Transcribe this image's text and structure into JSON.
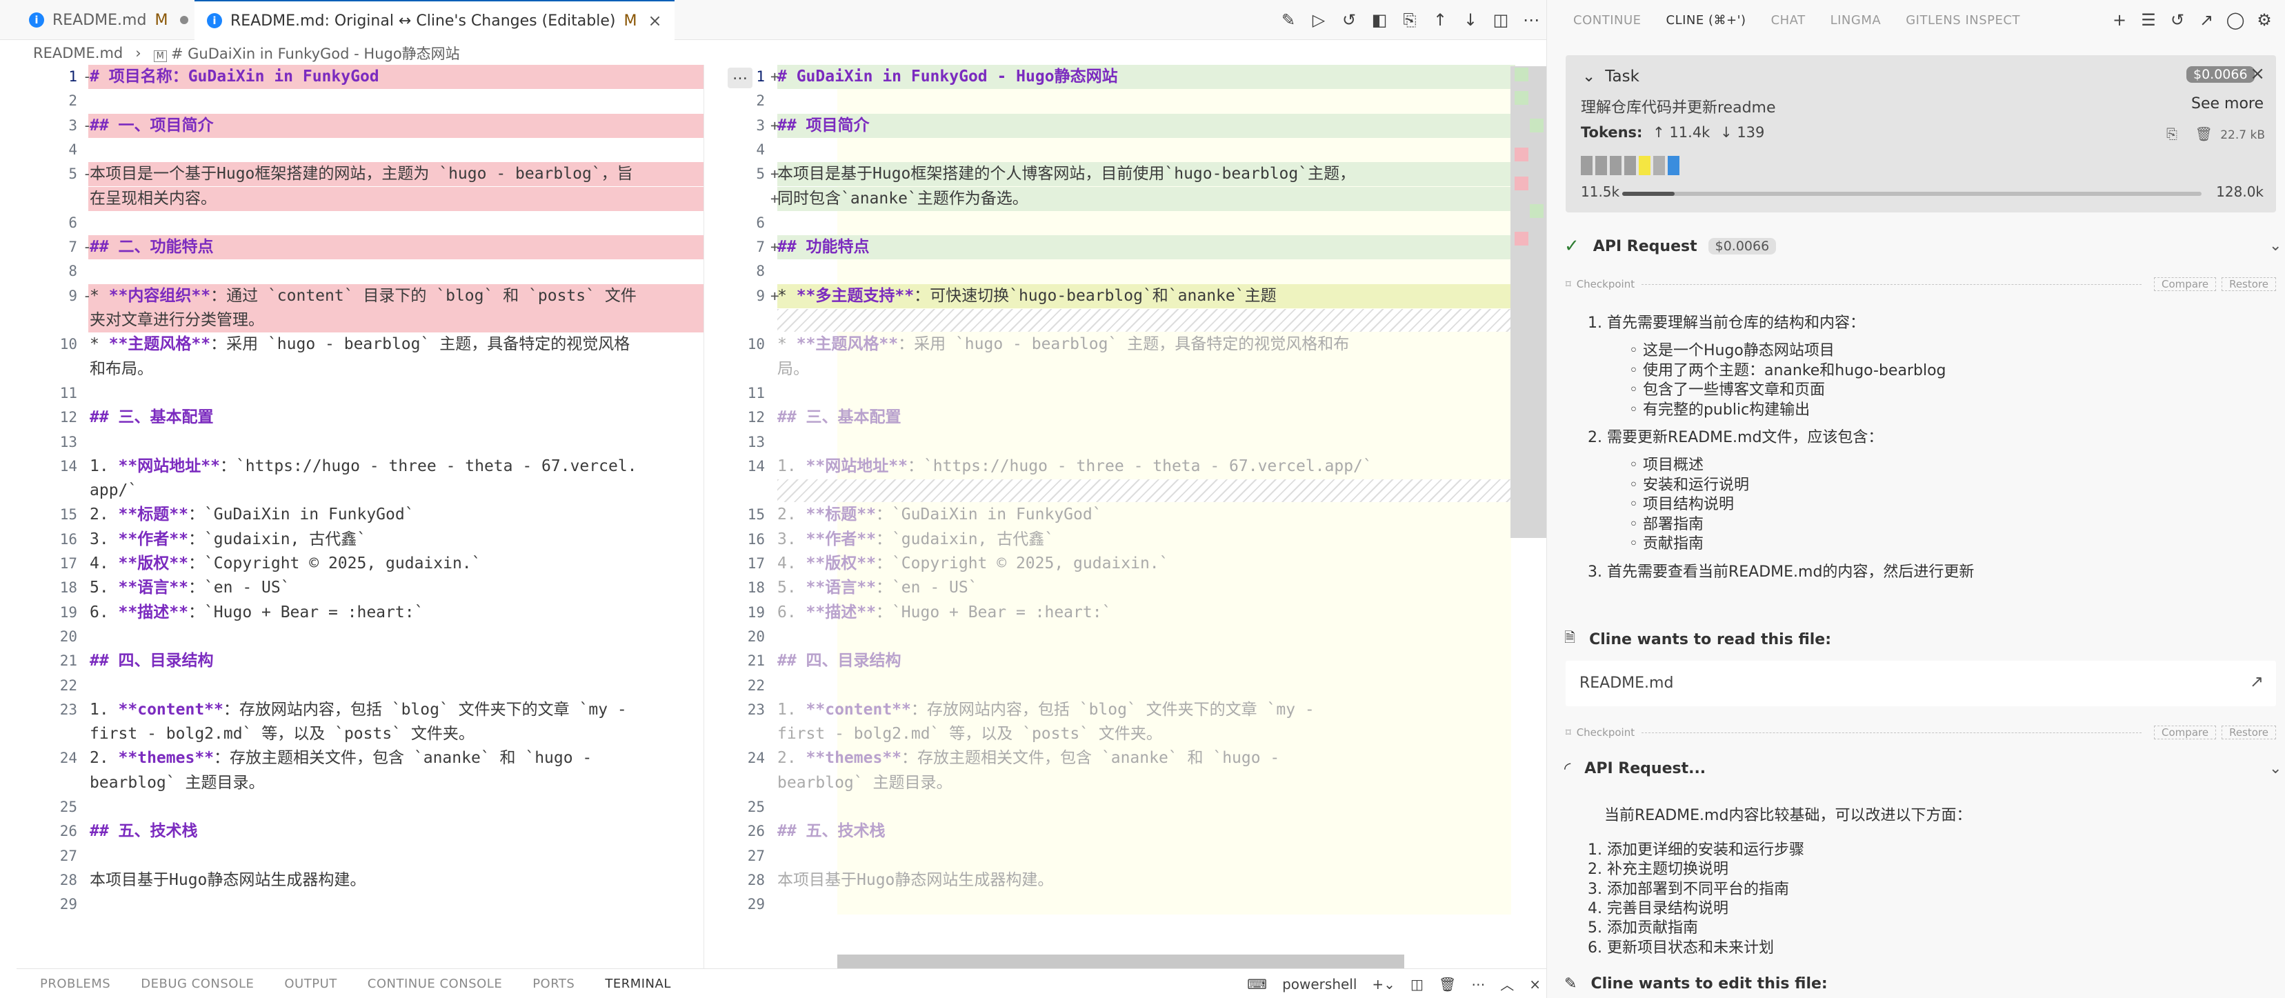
{
  "tabs": [
    {
      "label": "README.md",
      "status": "M"
    },
    {
      "label": "README.md: Original ↔ Cline's Changes (Editable)",
      "status": "M"
    }
  ],
  "breadcrumb": [
    "README.md",
    "# GuDaiXin in FunkyGod - Hugo静态网站"
  ],
  "left_lines": [
    {
      "n": "1",
      "mark": "-",
      "text": "# 项目名称：GuDaiXin in FunkyGod",
      "style": "heading",
      "bg": "del"
    },
    {
      "n": "2",
      "mark": "",
      "text": "",
      "bg": ""
    },
    {
      "n": "3",
      "mark": "-",
      "text": "## 一、项目简介",
      "style": "heading",
      "bg": "del"
    },
    {
      "n": "4",
      "mark": "",
      "text": "",
      "bg": ""
    },
    {
      "n": "5",
      "mark": "-",
      "text": "本项目是一个基于Hugo框架搭建的网站，主题为 `hugo - bearblog`，旨",
      "bg": "del"
    },
    {
      "n": "",
      "mark": "",
      "text": "在呈现相关内容。",
      "bg": "del"
    },
    {
      "n": "6",
      "mark": "",
      "text": "",
      "bg": ""
    },
    {
      "n": "7",
      "mark": "-",
      "text": "## 二、功能特点",
      "style": "heading",
      "bg": "del"
    },
    {
      "n": "8",
      "mark": "",
      "text": "",
      "bg": ""
    },
    {
      "n": "9",
      "mark": "-",
      "text": "* **内容组织**：通过 `content` 目录下的 `blog` 和 `posts` 文件",
      "style": "item",
      "bg": "del"
    },
    {
      "n": "",
      "mark": "",
      "text": "夹对文章进行分类管理。",
      "bg": "del"
    },
    {
      "n": "10",
      "mark": "",
      "text": "* **主题风格**：采用 `hugo - bearblog` 主题，具备特定的视觉风格",
      "style": "item",
      "bg": ""
    },
    {
      "n": "",
      "mark": "",
      "text": "和布局。",
      "bg": ""
    },
    {
      "n": "11",
      "mark": "",
      "text": "",
      "bg": ""
    },
    {
      "n": "12",
      "mark": "",
      "text": "## 三、基本配置",
      "style": "heading",
      "bg": ""
    },
    {
      "n": "13",
      "mark": "",
      "text": "",
      "bg": ""
    },
    {
      "n": "14",
      "mark": "",
      "text": "1. **网站地址**：`https://hugo - three - theta - 67.vercel.",
      "style": "item",
      "bg": ""
    },
    {
      "n": "",
      "mark": "",
      "text": "app/`",
      "bg": ""
    },
    {
      "n": "15",
      "mark": "",
      "text": "2. **标题**：`GuDaiXin in FunkyGod`",
      "style": "item",
      "bg": ""
    },
    {
      "n": "16",
      "mark": "",
      "text": "3. **作者**：`gudaixin, 古代鑫`",
      "style": "item",
      "bg": ""
    },
    {
      "n": "17",
      "mark": "",
      "text": "4. **版权**：`Copyright © 2025, gudaixin.`",
      "style": "item",
      "bg": ""
    },
    {
      "n": "18",
      "mark": "",
      "text": "5. **语言**：`en - US`",
      "style": "item",
      "bg": ""
    },
    {
      "n": "19",
      "mark": "",
      "text": "6. **描述**：`Hugo + Bear = :heart:`",
      "style": "item",
      "bg": ""
    },
    {
      "n": "20",
      "mark": "",
      "text": "",
      "bg": ""
    },
    {
      "n": "21",
      "mark": "",
      "text": "## 四、目录结构",
      "style": "heading",
      "bg": ""
    },
    {
      "n": "22",
      "mark": "",
      "text": "",
      "bg": ""
    },
    {
      "n": "23",
      "mark": "",
      "text": "1. **content**：存放网站内容，包括 `blog` 文件夹下的文章 `my -",
      "style": "item",
      "bg": ""
    },
    {
      "n": "",
      "mark": "",
      "text": "first - bolg2.md` 等，以及 `posts` 文件夹。",
      "bg": ""
    },
    {
      "n": "24",
      "mark": "",
      "text": "2. **themes**：存放主题相关文件，包含 `ananke` 和 `hugo -",
      "style": "item",
      "bg": ""
    },
    {
      "n": "",
      "mark": "",
      "text": "bearblog` 主题目录。",
      "bg": ""
    },
    {
      "n": "25",
      "mark": "",
      "text": "",
      "bg": ""
    },
    {
      "n": "26",
      "mark": "",
      "text": "## 五、技术栈",
      "style": "heading",
      "bg": ""
    },
    {
      "n": "27",
      "mark": "",
      "text": "",
      "bg": ""
    },
    {
      "n": "28",
      "mark": "",
      "text": "本项目基于Hugo静态网站生成器构建。",
      "bg": ""
    },
    {
      "n": "29",
      "mark": "",
      "text": "",
      "bg": ""
    }
  ],
  "right_lines": [
    {
      "n": "1",
      "mark": "+",
      "text": "# GuDaiXin in FunkyGod - Hugo静态网站",
      "style": "heading",
      "bg": "ins"
    },
    {
      "n": "2",
      "mark": "",
      "text": "",
      "bg": ""
    },
    {
      "n": "3",
      "mark": "+",
      "text": "## 项目简介",
      "style": "heading",
      "bg": "ins"
    },
    {
      "n": "4",
      "mark": "",
      "text": "",
      "bg": ""
    },
    {
      "n": "5",
      "mark": "+",
      "text": "本项目是基于Hugo框架搭建的个人博客网站，目前使用`hugo-bearblog`主题，",
      "bg": "ins"
    },
    {
      "n": "",
      "mark": "+",
      "text": "同时包含`ananke`主题作为备选。",
      "bg": "ins"
    },
    {
      "n": "6",
      "mark": "",
      "text": "",
      "bg": ""
    },
    {
      "n": "7",
      "mark": "+",
      "text": "## 功能特点",
      "style": "heading",
      "bg": "ins"
    },
    {
      "n": "8",
      "mark": "",
      "text": "",
      "bg": ""
    },
    {
      "n": "9",
      "mark": "+",
      "text": "* **多主题支持**：可快速切换`hugo-bearblog`和`ananke`主题",
      "style": "item",
      "bg": "yellow"
    },
    {
      "n": "",
      "mark": "",
      "text": "",
      "bg": "hatch"
    },
    {
      "n": "10",
      "mark": "",
      "text": "* **主题风格**：采用 `hugo - bearblog` 主题，具备特定的视觉风格和布",
      "style": "item",
      "bg": "",
      "faded": true
    },
    {
      "n": "",
      "mark": "",
      "text": "局。",
      "bg": "",
      "faded": true
    },
    {
      "n": "11",
      "mark": "",
      "text": "",
      "bg": ""
    },
    {
      "n": "12",
      "mark": "",
      "text": "## 三、基本配置",
      "style": "heading",
      "bg": "",
      "faded": true
    },
    {
      "n": "13",
      "mark": "",
      "text": "",
      "bg": ""
    },
    {
      "n": "14",
      "mark": "",
      "text": "1. **网站地址**：`https://hugo - three - theta - 67.vercel.app/`",
      "style": "item",
      "bg": "",
      "faded": true
    },
    {
      "n": "",
      "mark": "",
      "text": "",
      "bg": "hatch"
    },
    {
      "n": "15",
      "mark": "",
      "text": "2. **标题**：`GuDaiXin in FunkyGod`",
      "style": "item",
      "bg": "",
      "faded": true
    },
    {
      "n": "16",
      "mark": "",
      "text": "3. **作者**：`gudaixin, 古代鑫`",
      "style": "item",
      "bg": "",
      "faded": true
    },
    {
      "n": "17",
      "mark": "",
      "text": "4. **版权**：`Copyright © 2025, gudaixin.`",
      "style": "item",
      "bg": "",
      "faded": true
    },
    {
      "n": "18",
      "mark": "",
      "text": "5. **语言**：`en - US`",
      "style": "item",
      "bg": "",
      "faded": true
    },
    {
      "n": "19",
      "mark": "",
      "text": "6. **描述**：`Hugo + Bear = :heart:`",
      "style": "item",
      "bg": "",
      "faded": true
    },
    {
      "n": "20",
      "mark": "",
      "text": "",
      "bg": ""
    },
    {
      "n": "21",
      "mark": "",
      "text": "## 四、目录结构",
      "style": "heading",
      "bg": "",
      "faded": true
    },
    {
      "n": "22",
      "mark": "",
      "text": "",
      "bg": ""
    },
    {
      "n": "23",
      "mark": "",
      "text": "1. **content**：存放网站内容，包括 `blog` 文件夹下的文章 `my -",
      "style": "item",
      "bg": "",
      "faded": true
    },
    {
      "n": "",
      "mark": "",
      "text": "first - bolg2.md` 等，以及 `posts` 文件夹。",
      "bg": "",
      "faded": true
    },
    {
      "n": "24",
      "mark": "",
      "text": "2. **themes**：存放主题相关文件，包含 `ananke` 和 `hugo -",
      "style": "item",
      "bg": "",
      "faded": true
    },
    {
      "n": "",
      "mark": "",
      "text": "bearblog` 主题目录。",
      "bg": "",
      "faded": true
    },
    {
      "n": "25",
      "mark": "",
      "text": "",
      "bg": ""
    },
    {
      "n": "26",
      "mark": "",
      "text": "## 五、技术栈",
      "style": "heading",
      "bg": "",
      "faded": true
    },
    {
      "n": "27",
      "mark": "",
      "text": "",
      "bg": ""
    },
    {
      "n": "28",
      "mark": "",
      "text": "本项目基于Hugo静态网站生成器构建。",
      "bg": "",
      "faded": true
    },
    {
      "n": "29",
      "mark": "",
      "text": "",
      "bg": ""
    }
  ],
  "panel": {
    "tabs": [
      "PROBLEMS",
      "DEBUG CONSOLE",
      "OUTPUT",
      "CONTINUE CONSOLE",
      "PORTS",
      "TERMINAL"
    ],
    "active": "TERMINAL",
    "shell": "powershell"
  },
  "sidebar": {
    "tabs": [
      "CONTINUE",
      "CLINE (⌘+')",
      "CHAT",
      "LINGMA",
      "GITLENS INSPECT"
    ],
    "active_tab": "CLINE (⌘+')",
    "task": {
      "title": "Task",
      "cost": "$0.0066",
      "description": "理解仓库代码并更新readme",
      "see_more": "See more",
      "tokens_label": "Tokens:",
      "tokens_up": "↑ 11.4k",
      "tokens_down": "↓ 139",
      "size": "22.7 kB",
      "context_used": "11.5k",
      "context_max": "128.0k",
      "context_fraction": 0.09
    },
    "api_request": {
      "label": "API Request",
      "cost": "$0.0066"
    },
    "checkpoint": {
      "label": "Checkpoint",
      "compare": "Compare",
      "restore": "Restore"
    },
    "reasoning": [
      {
        "num": "1.",
        "text": "首先需要理解当前仓库的结构和内容："
      },
      {
        "bullet": true,
        "text": "这是一个Hugo静态网站项目"
      },
      {
        "bullet": true,
        "text": "使用了两个主题：ananke和hugo-bearblog"
      },
      {
        "bullet": true,
        "text": "包含了一些博客文章和页面"
      },
      {
        "bullet": true,
        "text": "有完整的public构建输出"
      },
      {
        "num": "2.",
        "text": "需要更新README.md文件，应该包含："
      },
      {
        "bullet": true,
        "text": "项目概述"
      },
      {
        "bullet": true,
        "text": "安装和运行说明"
      },
      {
        "bullet": true,
        "text": "项目结构说明"
      },
      {
        "bullet": true,
        "text": "部署指南"
      },
      {
        "bullet": true,
        "text": "贡献指南"
      },
      {
        "num": "3.",
        "text": "首先需要查看当前README.md的内容，然后进行更新"
      }
    ],
    "read_file": {
      "label": "Cline wants to read this file:",
      "file": "README.md"
    },
    "api_request_pending": "API Request...",
    "summary": "当前README.md内容比较基础，可以改进以下方面：",
    "improvements": [
      "1. 添加更详细的安装和运行步骤",
      "2. 补充主题切换说明",
      "3. 添加部署到不同平台的指南",
      "4. 完善目录结构说明",
      "5. 添加贡献指南",
      "6. 更新项目状态和未来计划"
    ],
    "edit_file": {
      "label": "Cline wants to edit this file:"
    }
  },
  "colors": {
    "deleted": "#f8c8cc",
    "inserted": "#e3f1dc",
    "accent": "#005fb8",
    "heading": "#7b2bbf"
  }
}
